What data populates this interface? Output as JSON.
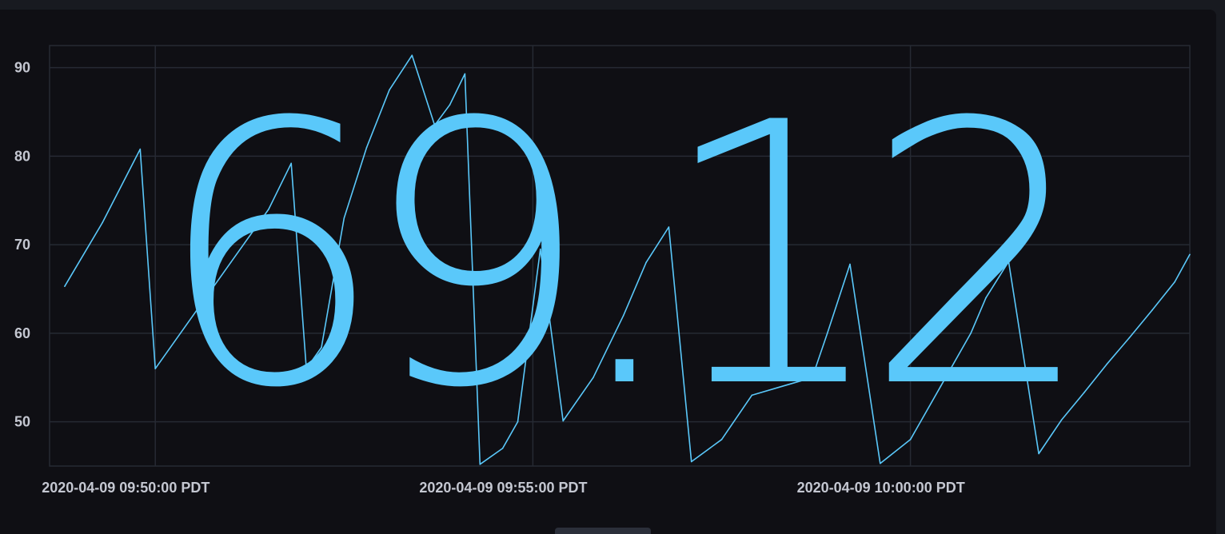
{
  "stat": {
    "value": "69.12",
    "color": "#5ac8fa"
  },
  "chart_data": {
    "type": "line",
    "title": "",
    "xlabel": "",
    "ylabel": "",
    "ylim": [
      45,
      92.5
    ],
    "y_ticks": [
      50,
      60,
      70,
      80,
      90
    ],
    "x_tick_labels": [
      "2020-04-09 09:50:00 PDT",
      "2020-04-09 09:55:00 PDT",
      "2020-04-09 10:00:00 PDT"
    ],
    "x_tick_minutes": [
      50,
      55,
      60
    ],
    "xlim_minutes": [
      48.6,
      63.7
    ],
    "grid": true,
    "series": [
      {
        "color": "#5ac8fa",
        "x": [
          48.8,
          49.3,
          49.8,
          50.0,
          50.5,
          51.0,
          51.5,
          51.8,
          52.0,
          52.2,
          52.5,
          52.8,
          53.1,
          53.4,
          53.7,
          53.9,
          54.1,
          54.3,
          54.6,
          54.8,
          55.1,
          55.4,
          55.8,
          56.2,
          56.5,
          56.8,
          57.1,
          57.5,
          57.9,
          58.3,
          58.7,
          58.9,
          59.2,
          59.6,
          60.0,
          60.4,
          60.8,
          61.0,
          61.3,
          61.7,
          62.0,
          62.3,
          62.6,
          62.9,
          63.2,
          63.5,
          63.7
        ],
        "y": [
          65.3,
          72.5,
          80.8,
          56.0,
          62.0,
          68.0,
          74.0,
          79.2,
          56.0,
          58.4,
          73.0,
          81.0,
          87.5,
          91.4,
          83.5,
          85.8,
          89.3,
          45.2,
          47.0,
          50.0,
          69.5,
          50.1,
          55.0,
          62.0,
          68.0,
          72.0,
          45.5,
          48.0,
          53.0,
          54.0,
          55.0,
          60.0,
          67.8,
          45.3,
          48.0,
          54.0,
          60.0,
          64.0,
          68.1,
          46.4,
          50.2,
          53.3,
          56.5,
          59.5,
          62.6,
          65.8,
          68.9
        ]
      }
    ]
  }
}
